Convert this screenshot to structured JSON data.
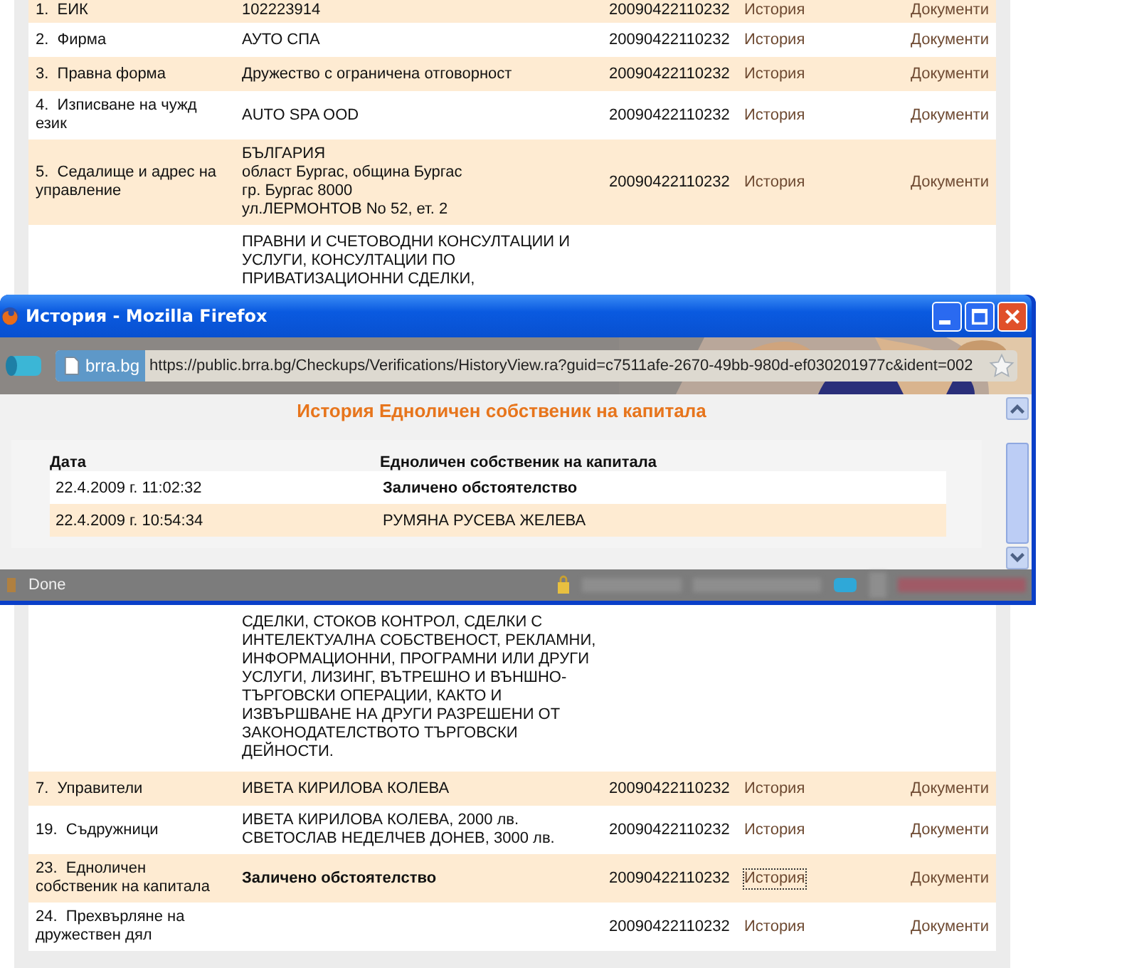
{
  "record_table": {
    "rows": [
      {
        "label": "1.  ЕИК",
        "value": "102223914",
        "date": "20090422110232",
        "history": {
          "label": "История",
          "focused": false
        },
        "documents": "Документи"
      },
      {
        "label": "2.  Фирма",
        "value": "АУТО СПА",
        "date": "20090422110232",
        "history": {
          "label": "История",
          "focused": false
        },
        "documents": "Документи"
      },
      {
        "label": "3.  Правна форма",
        "value": "Дружество с ограничена отговорност",
        "date": "20090422110232",
        "history": {
          "label": "История",
          "focused": false
        },
        "documents": "Документи"
      },
      {
        "label": "4.  Изписване на чужд\nезик",
        "value": "AUTO SPA OOD",
        "date": "20090422110232",
        "history": {
          "label": "История",
          "focused": false
        },
        "documents": "Документи"
      },
      {
        "label": "5.  Седалище и адрес на\nуправление",
        "value": "БЪЛГАРИЯ\nобласт Бургас, община Бургас\nгр. Бургас 8000\nул.ЛЕРМОНТОВ No 52, ет. 2",
        "date": "20090422110232",
        "history": {
          "label": "История",
          "focused": false
        },
        "documents": "Документи"
      },
      {
        "kind": "covered",
        "value_top": "ПРАВНИ И СЧЕТОВОДНИ КОНСУЛТАЦИИ И\nУСЛУГИ, КОНСУЛТАЦИИ ПО\nПРИВАТИЗАЦИОННИ СДЕЛКИ,",
        "value_bottom": "СДЕЛКИ, СТОКОВ КОНТРОЛ, СДЕЛКИ С\nИНТЕЛЕКТУАЛНА СОБСТВЕНОСТ, РЕКЛАМНИ,\nИНФОРМАЦИОННИ, ПРОГРАМНИ ИЛИ ДРУГИ\nУСЛУГИ, ЛИЗИНГ, ВЪТРЕШНО И ВЪНШНО-\nТЪРГОВСКИ ОПЕРАЦИИ, КАКТО И\nИЗВЪРШВАНЕ НА ДРУГИ РАЗРЕШЕНИ ОТ\nЗАКОНОДАТЕЛСТВОТО ТЪРГОВСКИ\nДЕЙНОСТИ."
      },
      {
        "label": "7.  Управители",
        "value": "ИВЕТА КИРИЛОВА КОЛЕВА",
        "date": "20090422110232",
        "history": {
          "label": "История",
          "focused": false
        },
        "documents": "Документи"
      },
      {
        "label": "19.  Съдружници",
        "value": "ИВЕТА КИРИЛОВА КОЛЕВА, 2000 лв.\nСВЕТОСЛАВ НЕДЕЛЧЕВ ДОНЕВ, 3000 лв.",
        "date": "20090422110232",
        "history": {
          "label": "История",
          "focused": false
        },
        "documents": "Документи"
      },
      {
        "label": "23.  Едноличен\nсобственик на капитала",
        "value": "Заличено обстоятелство",
        "value_bold": true,
        "date": "20090422110232",
        "history": {
          "label": "История",
          "focused": true
        },
        "documents": "Документи"
      },
      {
        "label": "24.  Прехвърляне на\nдружествен дял",
        "date": "20090422110232",
        "history": {
          "label": "История",
          "focused": false
        },
        "documents": "Документи"
      }
    ]
  },
  "popup": {
    "window": {
      "title": "История - Mozilla Firefox"
    },
    "address_bar": {
      "site": "brra.bg",
      "url": "https://public.brra.bg/Checkups/Verifications/HistoryView.ra?guid=c7511afe-2670-49bb-980d-ef030201977c&ident=002"
    },
    "heading": "История Едноличен собственик на капитала",
    "history_table": {
      "columns": [
        "Дата",
        "Едноличен собственик на капитала"
      ],
      "rows": [
        {
          "date": "22.4.2009 г. 11:02:32",
          "value": "Заличено обстоятелство",
          "value_bold": true
        },
        {
          "date": "22.4.2009 г. 10:54:34",
          "value": "РУМЯНА РУСЕВА ЖЕЛЕВА",
          "value_bold": false
        }
      ]
    },
    "status_bar": {
      "text": "Done"
    }
  }
}
